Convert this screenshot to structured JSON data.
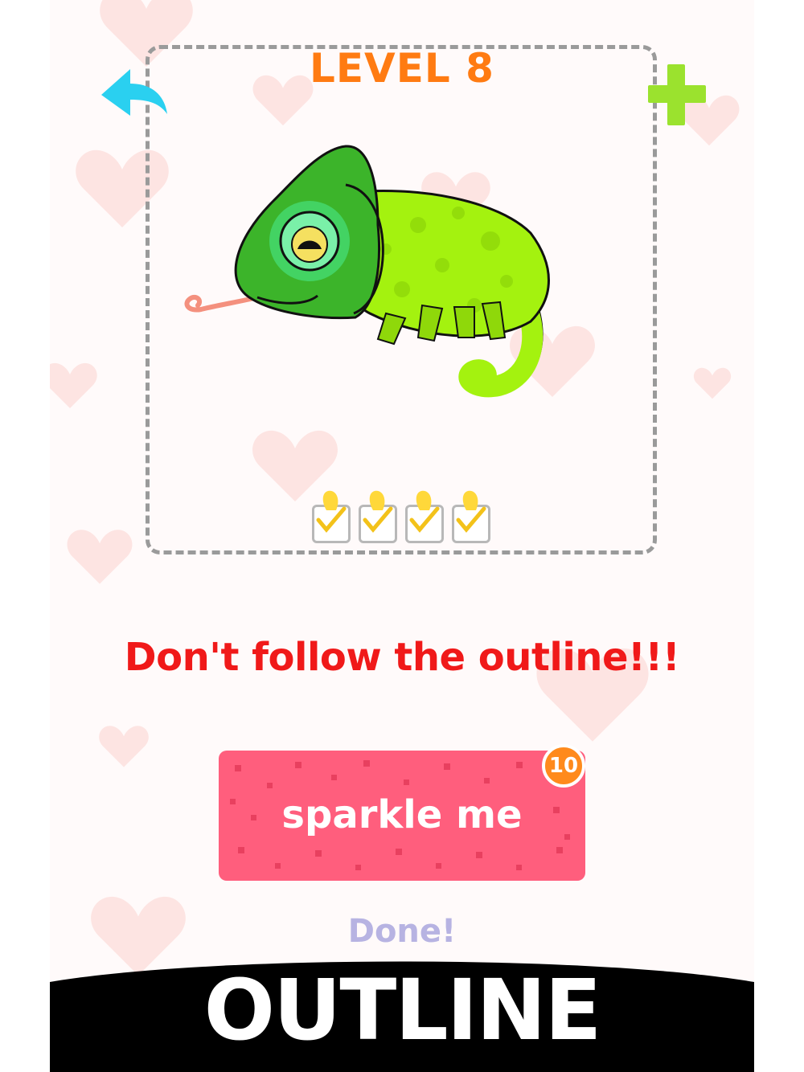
{
  "header": {
    "level_label": "LEVEL 8"
  },
  "icons": {
    "back": "back-arrow-icon",
    "add": "plus-icon",
    "badge": "coin-badge"
  },
  "puzzle": {
    "subject": "chameleon",
    "hints_used": 4,
    "hints_total": 4
  },
  "hint_text": "Don't follow the outline!!!",
  "sparkle_button": {
    "label": "sparkle me",
    "cost": "10"
  },
  "done_label": "Done!",
  "banner": {
    "text": "OUTLINE"
  },
  "colors": {
    "level": "#ff7b12",
    "hint": "#f01919",
    "button": "#ff5e7d",
    "badge": "#ff8a1c",
    "done": "#b7b3e2",
    "back_arrow": "#2ad0f0",
    "plus": "#9be22e"
  }
}
